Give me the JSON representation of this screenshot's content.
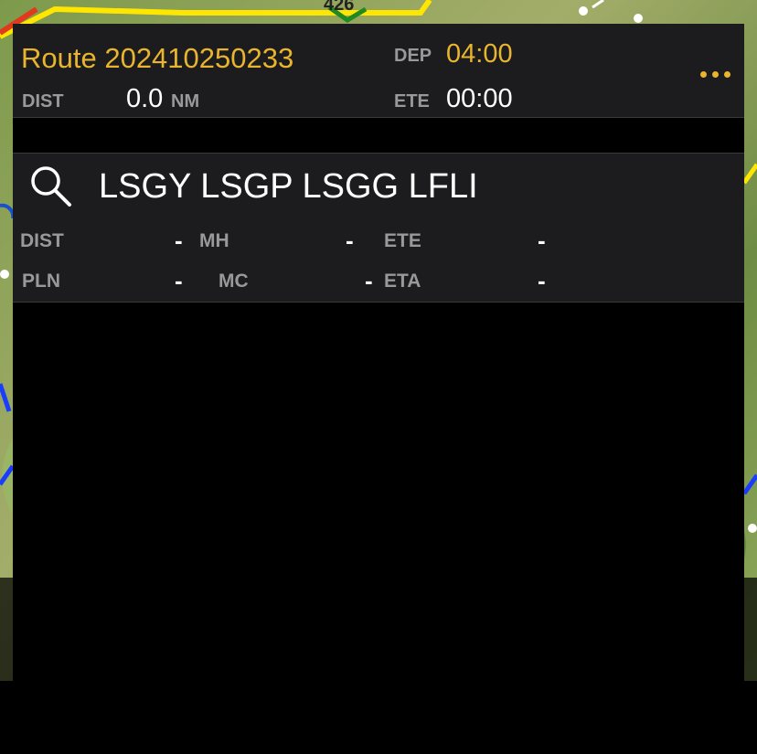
{
  "header": {
    "route_title": "Route 202410250233",
    "dep_label": "DEP",
    "dep_value": "04:00",
    "dist_label": "DIST",
    "dist_value": "0.0",
    "dist_unit": "NM",
    "ete_label": "ETE",
    "ete_value": "00:00"
  },
  "search": {
    "value": "LSGY LSGP LSGG LFLI"
  },
  "leg_stats": {
    "dist_label": "DIST",
    "dist_value": "-",
    "mh_label": "MH",
    "mh_value": "-",
    "ete_label": "ETE",
    "ete_value": "-",
    "pln_label": "PLN",
    "pln_value": "-",
    "mc_label": "MC",
    "mc_value": "-",
    "eta_label": "ETA",
    "eta_value": "-"
  },
  "map": {
    "road_label": "426"
  },
  "colors": {
    "accent": "#e9b52e",
    "panel": "#1c1c1e",
    "label": "#98989d"
  },
  "icons": [
    "search-icon",
    "more-icon"
  ]
}
